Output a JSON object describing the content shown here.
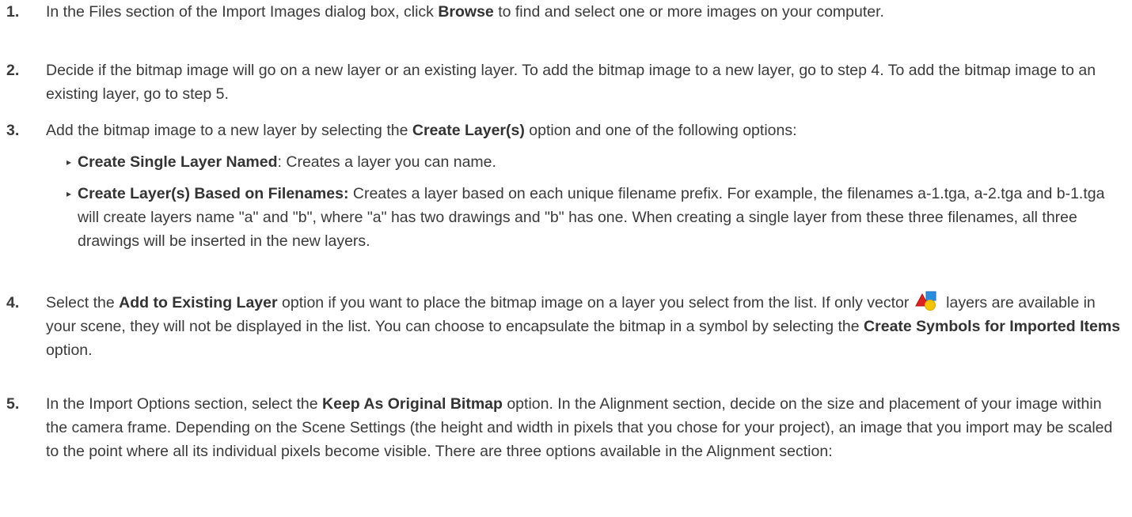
{
  "steps": [
    {
      "num": "1.",
      "parts": [
        "In the Files section of the Import Images dialog box, click ",
        "Browse",
        " to find and select one or more images on your computer."
      ]
    },
    {
      "num": "2.",
      "text": "Decide if the bitmap image will go on a new layer or an existing layer. To add the bitmap image to a new layer, go to step 4. To add the bitmap image to an existing layer, go to step 5."
    },
    {
      "num": "3.",
      "parts": [
        "Add the bitmap image to a new layer by selecting the ",
        "Create Layer(s)",
        " option and one of the following options:"
      ],
      "bullets": [
        {
          "label": "Create Single Layer Named",
          "text": ": Creates a layer you can name."
        },
        {
          "label": "Create Layer(s) Based on Filenames:",
          "text": " Creates a layer based on each unique filename prefix. For example, the filenames a-1.tga, a-2.tga and b-1.tga will create layers name \"a\" and \"b\", where \"a\" has two drawings and \"b\" has one. When creating a single layer from these three filenames, all three drawings will be inserted in the new layers."
        }
      ]
    },
    {
      "num": "4.",
      "parts": [
        "Select the ",
        "Add to Existing Layer",
        " option if you want to place the bitmap image on a layer you select from the list. If only vector ",
        " layers are available in your scene, they will not be displayed in the list. You can choose to encapsulate the bitmap in a symbol by selecting the ",
        "Create Symbols for Imported Items",
        " option."
      ],
      "icon": "vector-layer-icon"
    },
    {
      "num": "5.",
      "parts": [
        "In the Import Options section, select the ",
        "Keep As Original Bitmap",
        " option. In the Alignment section, decide on the size and placement of your image within the camera frame. Depending on the Scene Settings (the height and width in pixels that you chose for your project), an image that you import may be scaled to the point where all its individual pixels become visible. There are three options available in the Alignment section:"
      ]
    }
  ],
  "colors": {
    "text": "#3a3a3a",
    "icon_red": "#e02020",
    "icon_blue": "#2a8de0",
    "icon_yellow": "#f5c400"
  }
}
